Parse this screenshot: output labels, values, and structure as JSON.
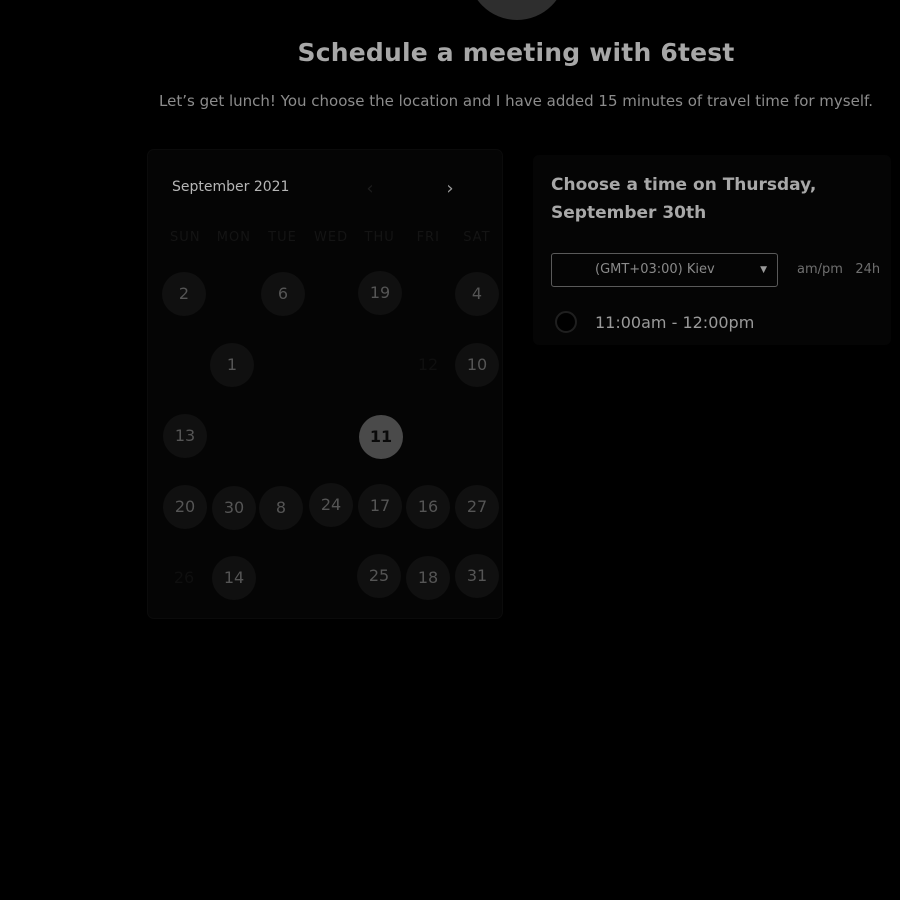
{
  "header": {
    "title": "Schedule a meeting with 6test",
    "description": "Let’s get lunch! You choose the location and I have added 15 minutes of travel time for myself."
  },
  "calendar": {
    "month_label": "September 2021",
    "prev_icon": "chevron-left-icon",
    "next_icon": "chevron-right-icon",
    "weekdays": [
      "SUN",
      "MON",
      "TUE",
      "WED",
      "THU",
      "FRI",
      "SAT"
    ],
    "days": [
      {
        "label": "2",
        "state": "available"
      },
      {
        "label": "6",
        "state": "available"
      },
      {
        "label": "19",
        "state": "available"
      },
      {
        "label": "4",
        "state": "available"
      },
      {
        "label": "1",
        "state": "available"
      },
      {
        "label": "12",
        "state": "disabled"
      },
      {
        "label": "10",
        "state": "available"
      },
      {
        "label": "13",
        "state": "available"
      },
      {
        "label": "11",
        "state": "selected"
      },
      {
        "label": "20",
        "state": "available"
      },
      {
        "label": "30",
        "state": "available"
      },
      {
        "label": "8",
        "state": "available"
      },
      {
        "label": "24",
        "state": "available"
      },
      {
        "label": "17",
        "state": "available"
      },
      {
        "label": "16",
        "state": "available"
      },
      {
        "label": "27",
        "state": "available"
      },
      {
        "label": "26",
        "state": "disabled"
      },
      {
        "label": "14",
        "state": "available"
      },
      {
        "label": "25",
        "state": "available"
      },
      {
        "label": "18",
        "state": "available"
      },
      {
        "label": "31",
        "state": "available"
      }
    ]
  },
  "time_panel": {
    "heading": "Choose a time on Thursday, September 30th",
    "timezone": "(GMT+03:00) Kiev",
    "format_ampm": "am/pm",
    "format_24h": "24h",
    "slots": [
      {
        "label": "11:00am - 12:00pm"
      }
    ]
  }
}
